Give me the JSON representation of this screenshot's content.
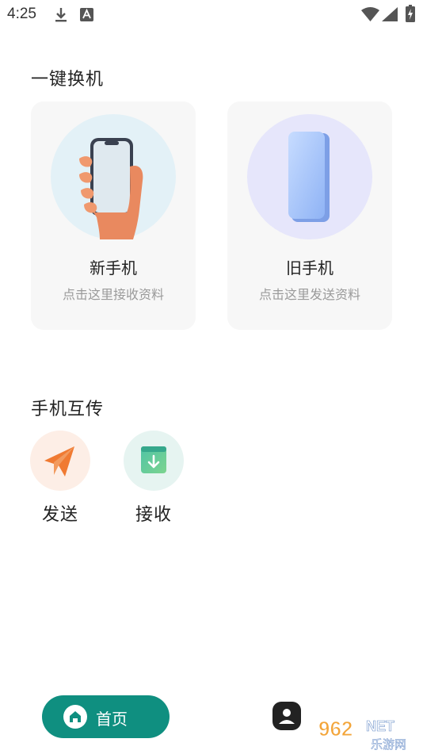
{
  "status_bar": {
    "time": "4:25",
    "icons": [
      "download-icon",
      "a-notification-icon",
      "wifi-icon",
      "signal-icon",
      "battery-charging-icon"
    ]
  },
  "one_key_switch": {
    "title": "一键换机",
    "cards": [
      {
        "title": "新手机",
        "subtitle": "点击这里接收资料",
        "icon": "hand-holding-phone-icon",
        "circle_color": "#e3f1f7"
      },
      {
        "title": "旧手机",
        "subtitle": "点击这里发送资料",
        "icon": "blue-phone-icon",
        "circle_color": "#e6e6fb"
      }
    ]
  },
  "phone_transfer": {
    "title": "手机互传",
    "items": [
      {
        "label": "发送",
        "icon": "paper-plane-icon",
        "circle_color": "#fdeee6"
      },
      {
        "label": "接收",
        "icon": "download-box-icon",
        "circle_color": "#e6f4f1"
      }
    ]
  },
  "bottom_nav": {
    "home_label": "首页",
    "accent": "#0f8f80"
  },
  "watermark": {
    "text": "962 NET",
    "subtext": "乐游网"
  }
}
